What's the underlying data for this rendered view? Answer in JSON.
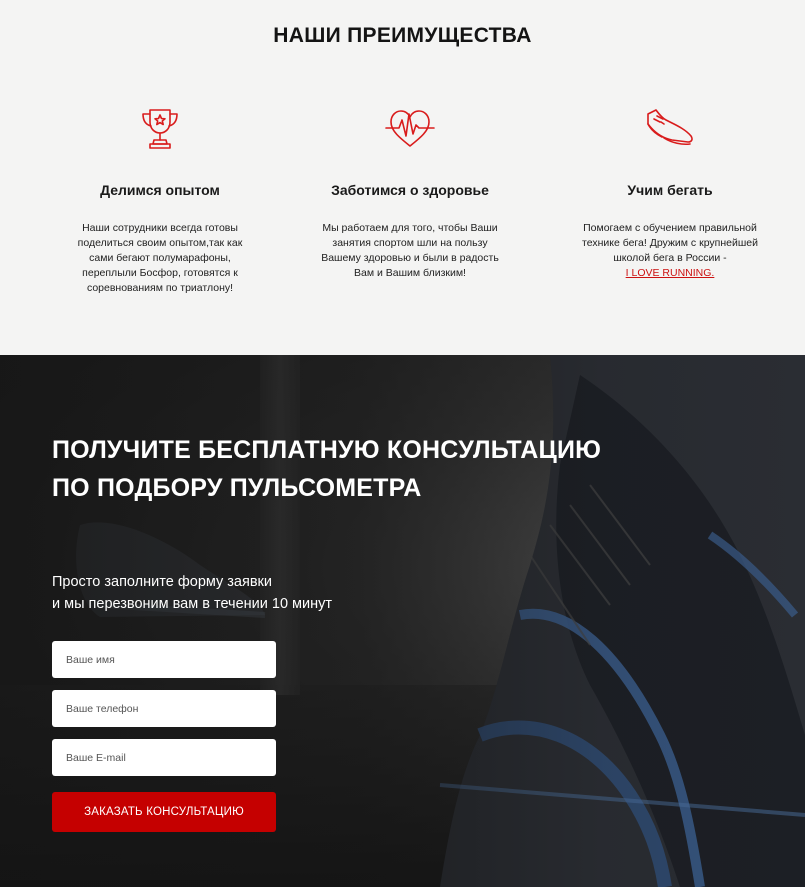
{
  "advantages": {
    "title": "НАШИ ПРЕИМУЩЕСТВА",
    "accent_color": "#d91c1c",
    "items": [
      {
        "icon": "trophy-icon",
        "caption": "Делимся опытом",
        "text": "Наши сотрудники всегда готовы поделиться своим опытом,так как сами бегают полумарафоны, переплыли Босфор, готовятся к соревнованиям по триатлону!"
      },
      {
        "icon": "heart-pulse-icon",
        "caption": "Заботимся о здоровье",
        "text": "Мы работаем для того, чтобы Ваши занятия спортом шли на пользу Вашему здоровью и были в радость Вам и Вашим близким!"
      },
      {
        "icon": "running-shoe-icon",
        "caption": "Учим бегать",
        "text": "Помогаем с обучением правильной технике бега! Дружим с крупнейшей школой бега в России -",
        "link": "I LOVE RUNNING."
      }
    ]
  },
  "consultation": {
    "heading_line1": "ПОЛУЧИТЕ БЕСПЛАТНУЮ КОНСУЛЬТАЦИЮ",
    "heading_line2": "ПО ПОДБОРУ ПУЛЬСОМЕТРА",
    "sub_line1": "Просто заполните форму заявки",
    "sub_line2": "и мы перезвоним вам в течении 10 минут",
    "form": {
      "name_placeholder": "Ваше имя",
      "phone_placeholder": "Ваше телефон",
      "email_placeholder": "Ваше E-mail",
      "submit_label": "ЗАКАЗАТЬ КОНСУЛЬТАЦИЮ",
      "submit_color": "#c50000"
    }
  }
}
